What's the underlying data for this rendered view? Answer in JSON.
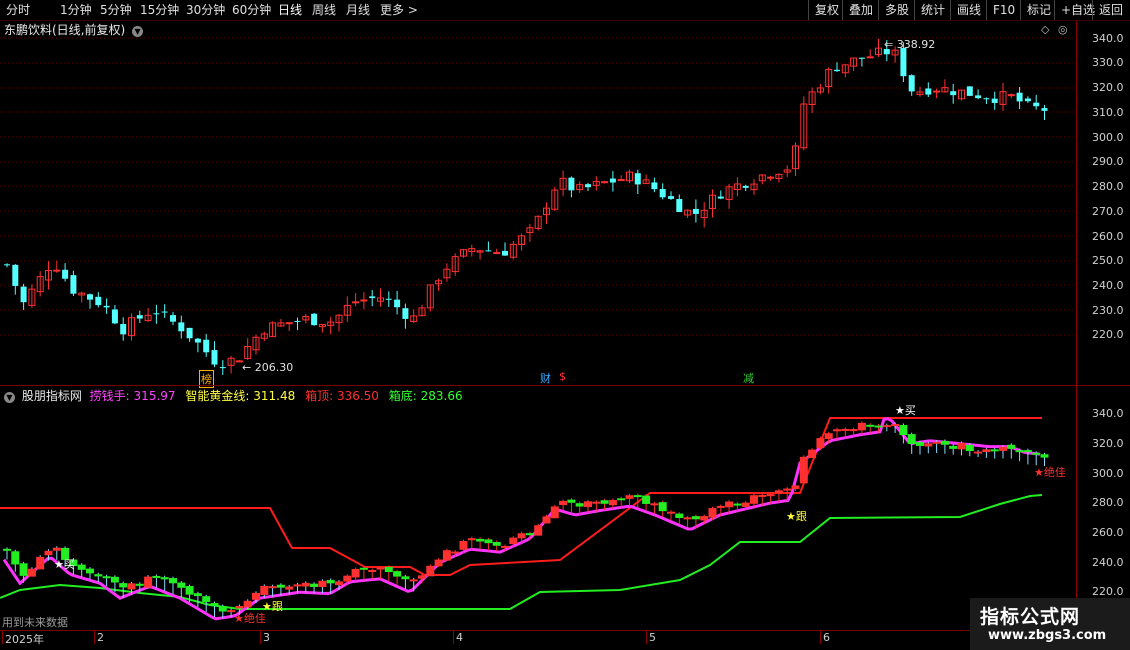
{
  "toolbar": {
    "left": [
      "分时",
      "1分钟",
      "5分钟",
      "15分钟",
      "30分钟",
      "60分钟",
      "日线",
      "周线",
      "月线",
      "更多"
    ],
    "active": "日线",
    "right": [
      "复权",
      "叠加",
      "多股",
      "统计",
      "画线",
      "F10",
      "标记",
      "+自选",
      "返回"
    ]
  },
  "main": {
    "title": "东鹏饮料(日线,前复权)",
    "y_labels": [
      "340.0",
      "330.0",
      "320.0",
      "310.0",
      "300.0",
      "290.0",
      "280.0",
      "270.0",
      "260.0",
      "250.0",
      "240.0",
      "230.0",
      "220.0"
    ],
    "high_label": "338.92",
    "low_label": "206.30",
    "markers": [
      {
        "text": "榜",
        "color": "#ffb000"
      },
      {
        "text": "财",
        "color": "#33aaff"
      },
      {
        "text": "$",
        "color": "#ff3030"
      },
      {
        "text": "减",
        "color": "#33cc33"
      }
    ]
  },
  "indicator": {
    "name": "股朋指标网",
    "values": [
      {
        "label": "捞钱手:",
        "value": "315.97",
        "color": "#ff44ff"
      },
      {
        "label": "智能黄金线:",
        "value": "311.48",
        "color": "#ffff44"
      },
      {
        "label": "箱顶:",
        "value": "336.50",
        "color": "#ff3030"
      },
      {
        "label": "箱底:",
        "value": "283.66",
        "color": "#33ff33"
      }
    ],
    "y_labels": [
      "340.0",
      "320.0",
      "300.0",
      "280.0",
      "260.0",
      "240.0",
      "220.0"
    ],
    "annotations": {
      "buy1": "买",
      "buy2": "买",
      "follow1": "跟",
      "follow2": "跟",
      "best1": "绝佳",
      "best2": "绝佳"
    },
    "note": "用到未来数据"
  },
  "xaxis": {
    "labels": [
      "2025年",
      "2",
      "3",
      "4",
      "5",
      "6"
    ]
  },
  "watermark": {
    "main": "指标公式网",
    "url": "www.zbgs3.com"
  },
  "colors": {
    "up": "#ff3030",
    "down": "#54ffff",
    "box_top": "#ff1c1c",
    "box_bottom": "#22ee22",
    "money_line": "#ff33ff"
  }
}
